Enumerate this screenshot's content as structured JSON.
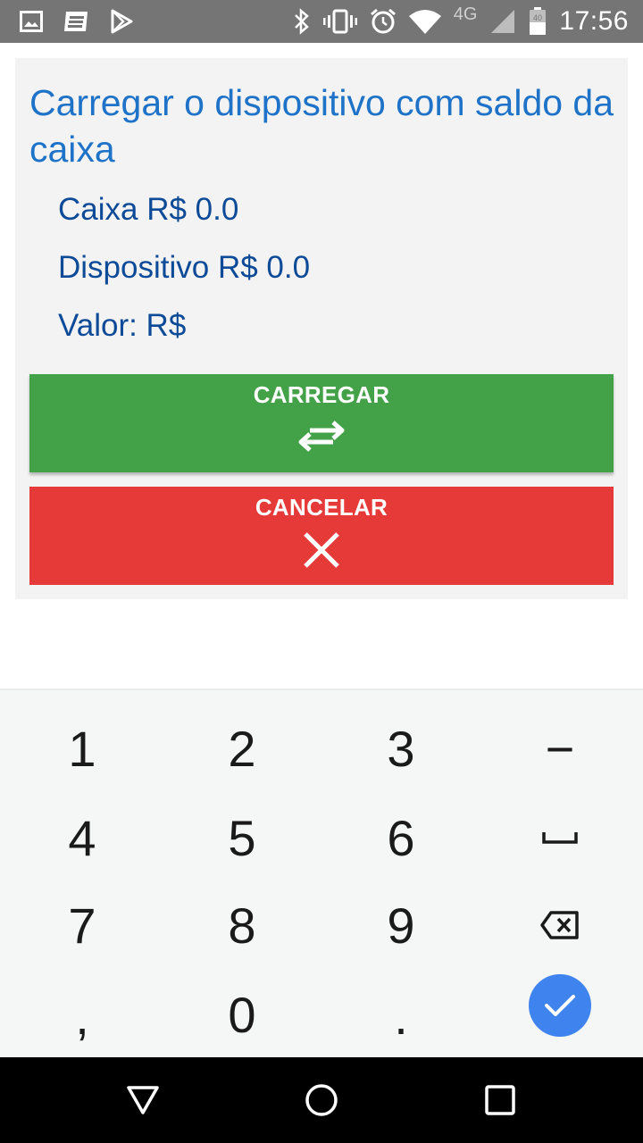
{
  "status_bar": {
    "time": "17:56",
    "network": "4G",
    "battery_level": "40",
    "icons": [
      "image-icon",
      "news-icon",
      "play-store-icon",
      "bluetooth-icon",
      "vibrate-icon",
      "alarm-icon",
      "wifi-icon",
      "signal-icon",
      "battery-icon"
    ]
  },
  "card": {
    "title": "Carregar o dispositivo com saldo da caixa",
    "caixa": "Caixa R$ 0.0",
    "dispositivo": "Dispositivo R$ 0.0",
    "valor": "Valor: R$"
  },
  "buttons": {
    "carregar_label": "CARREGAR",
    "carregar_icon": "swap-arrows-icon",
    "carregar_color": "#43a148",
    "cancelar_label": "CANCELAR",
    "cancelar_icon": "close-icon",
    "cancelar_color": "#e53a37"
  },
  "keypad": {
    "keys": [
      "1",
      "2",
      "3",
      "−",
      "4",
      "5",
      "6",
      "␣",
      "7",
      "8",
      "9",
      "⌫",
      ",",
      "0",
      ".",
      "✓"
    ],
    "done_color": "#3f83ee"
  },
  "nav": {
    "icons": [
      "back-icon",
      "home-icon",
      "recents-icon"
    ]
  }
}
